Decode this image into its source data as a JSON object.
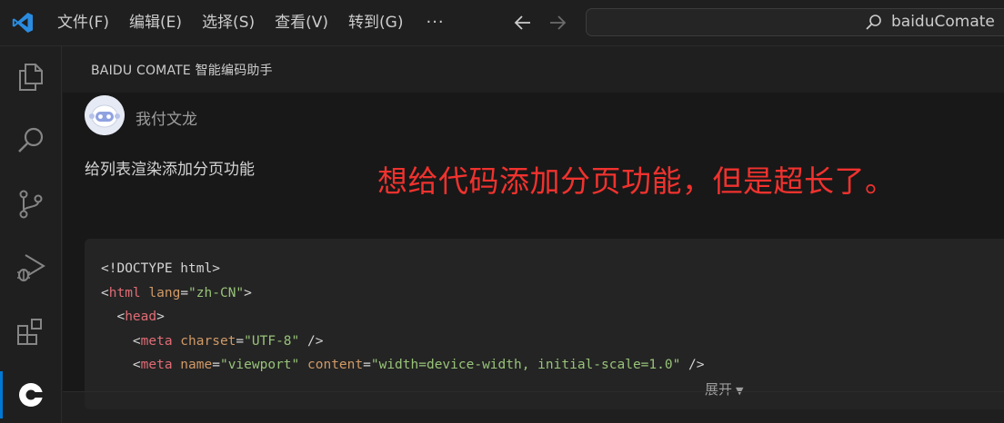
{
  "menu": {
    "items": [
      "文件(F)",
      "编辑(E)",
      "选择(S)",
      "查看(V)",
      "转到(G)"
    ],
    "more": "···"
  },
  "command_center": {
    "text": "baiduComate"
  },
  "panel": {
    "title": "BAIDU COMATE 智能编码助手"
  },
  "chat": {
    "user_name": "我付文龙",
    "prompt": "给列表渲染添加分页功能",
    "annotation": "想给代码添加分页功能，但是超长了。",
    "code": {
      "l1_doctype": "<!DOCTYPE html>",
      "l2_open": "<",
      "l2_tag": "html",
      "l2_attr": " lang",
      "l2_eq": "=",
      "l2_val": "\"zh-CN\"",
      "l2_close": ">",
      "l3_indent": "  ",
      "l3_open": "<",
      "l3_tag": "head",
      "l3_close": ">",
      "l4_indent": "    ",
      "l4_open": "<",
      "l4_tag": "meta",
      "l4_attr": " charset",
      "l4_eq": "=",
      "l4_val": "\"UTF-8\"",
      "l4_close": " />",
      "l5_indent": "    ",
      "l5_open": "<",
      "l5_tag": "meta",
      "l5_attr1": " name",
      "l5_eq1": "=",
      "l5_val1": "\"viewport\"",
      "l5_attr2": " content",
      "l5_eq2": "=",
      "l5_val2": "\"width=device-width, initial-scale=1.0\"",
      "l5_close": " />"
    },
    "expand_label": "展开",
    "expand_caret": "▼"
  },
  "colors": {
    "accent": "#0078d4",
    "annotation": "#f0322e"
  }
}
